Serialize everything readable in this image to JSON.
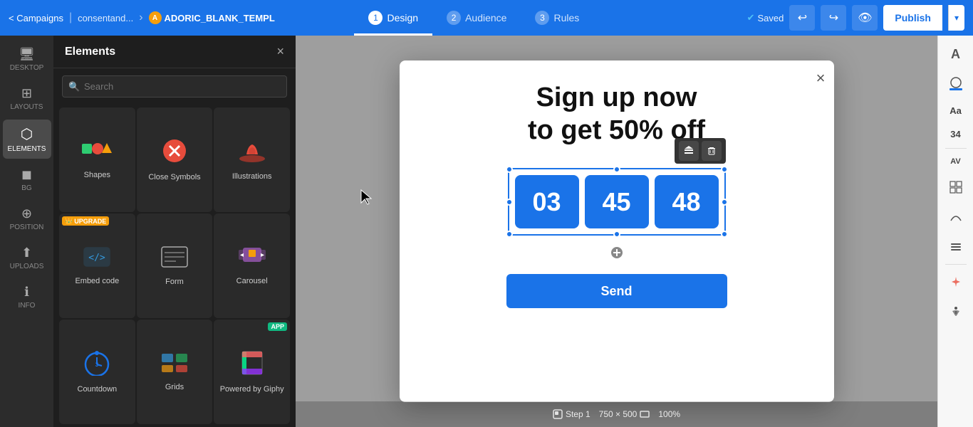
{
  "nav": {
    "back_label": "< Campaigns",
    "breadcrumb": "consentand...",
    "campaign_name": "ADORIC_BLANK_TEMPL",
    "tabs": [
      {
        "num": "1",
        "label": "Design",
        "active": true
      },
      {
        "num": "2",
        "label": "Audience",
        "active": false
      },
      {
        "num": "3",
        "label": "Rules",
        "active": false
      }
    ],
    "saved_label": "Saved",
    "undo_icon": "↩",
    "redo_icon": "↪",
    "preview_icon": "👁",
    "publish_label": "Publish",
    "publish_arrow": "▾"
  },
  "left_sidebar": {
    "items": [
      {
        "id": "desktop",
        "icon": "🖥",
        "label": "DESKTOP"
      },
      {
        "id": "layouts",
        "icon": "⊞",
        "label": "LAYOUTS"
      },
      {
        "id": "elements",
        "icon": "⬡",
        "label": "ELEMENTS",
        "active": true
      },
      {
        "id": "bg",
        "icon": "🎨",
        "label": "BG"
      },
      {
        "id": "position",
        "icon": "⊕",
        "label": "POSITION"
      },
      {
        "id": "uploads",
        "icon": "⬆",
        "label": "UPLOADS"
      },
      {
        "id": "info",
        "icon": "ℹ",
        "label": "INFO"
      }
    ]
  },
  "elements_panel": {
    "title": "Elements",
    "close_label": "×",
    "search_placeholder": "Search",
    "items": [
      {
        "id": "shapes",
        "label": "Shapes",
        "icon": "shapes",
        "badge": null
      },
      {
        "id": "close-symbols",
        "label": "Close Symbols",
        "icon": "close",
        "badge": null
      },
      {
        "id": "illustrations",
        "label": "Illustrations",
        "icon": "illustration",
        "badge": null
      },
      {
        "id": "embed-code",
        "label": "Embed code",
        "icon": "embed",
        "badge": "UPGRADE"
      },
      {
        "id": "form",
        "label": "Form",
        "icon": "form",
        "badge": null
      },
      {
        "id": "carousel",
        "label": "Carousel",
        "icon": "carousel",
        "badge": null
      },
      {
        "id": "countdown",
        "label": "Countdown",
        "icon": "countdown",
        "badge": null
      },
      {
        "id": "grids",
        "label": "Grids",
        "icon": "grids",
        "badge": null
      },
      {
        "id": "powered-by-giphy",
        "label": "Powered by Giphy",
        "icon": "giphy",
        "badge": "APP"
      }
    ]
  },
  "popup": {
    "heading_line1": "Sign up now",
    "heading_line2": "to get 50% off",
    "countdown": {
      "blocks": [
        {
          "value": "03"
        },
        {
          "value": "45"
        },
        {
          "value": "48"
        }
      ]
    },
    "send_button_label": "Send",
    "close_icon": "×"
  },
  "toolbar": {
    "layers_icon": "⊕",
    "delete_icon": "🗑"
  },
  "status_bar": {
    "step_label": "Step 1",
    "dimensions": "750 × 500",
    "zoom": "100%"
  },
  "right_panel": {
    "font_icon": "A",
    "color_icon": "🎨",
    "font_size_label": "Aa",
    "number_label": "34",
    "av_label": "AV",
    "grid_icon": "⊞",
    "curve_icon": "⌒",
    "spacing_icon": "⊟",
    "magic_icon": "✦",
    "accessibility_icon": "♿"
  }
}
